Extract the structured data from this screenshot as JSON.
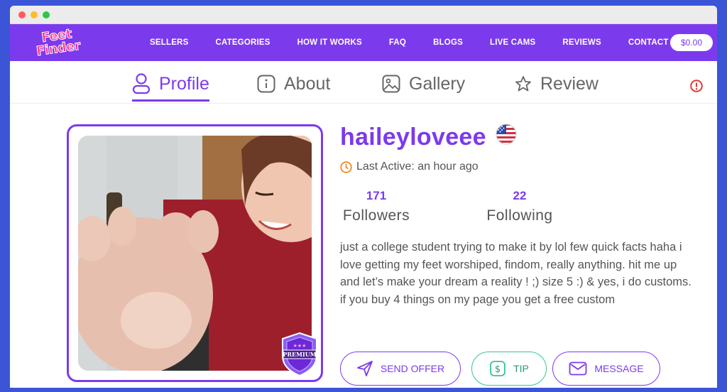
{
  "nav": {
    "logo_line1": "Feet",
    "logo_line2": "Finder",
    "links": [
      "SELLERS",
      "CATEGORIES",
      "HOW IT WORKS",
      "FAQ",
      "BLOGS",
      "LIVE CAMS",
      "REVIEWS",
      "CONTACT"
    ],
    "balance": "$0.00"
  },
  "tabs": [
    {
      "label": "Profile",
      "icon": "user-icon",
      "active": true
    },
    {
      "label": "About",
      "icon": "info-icon",
      "active": false
    },
    {
      "label": "Gallery",
      "icon": "image-icon",
      "active": false
    },
    {
      "label": "Review",
      "icon": "star-icon",
      "active": false
    }
  ],
  "profile": {
    "username": "haileyloveee",
    "flag": "us-flag-icon",
    "last_active": "Last Active: an hour ago",
    "followers_count": "171",
    "followers_label": "Followers",
    "following_count": "22",
    "following_label": "Following",
    "bio": "just a college student trying to make it by lol few quick facts haha i love getting my feet worshiped, findom, really anything. hit me up and let’s make your dream a reality ! ;) size 5 :) & yes, i do customs. if you buy 4 things on my page you get a free custom",
    "badge": "PREMIUM"
  },
  "actions": {
    "send_offer": "SEND OFFER",
    "tip": "TIP",
    "message": "MESSAGE"
  },
  "colors": {
    "accent": "#7c3aed",
    "tip_green": "#34c490",
    "alert_red": "#e53935",
    "clock_orange": "#f08a24"
  }
}
